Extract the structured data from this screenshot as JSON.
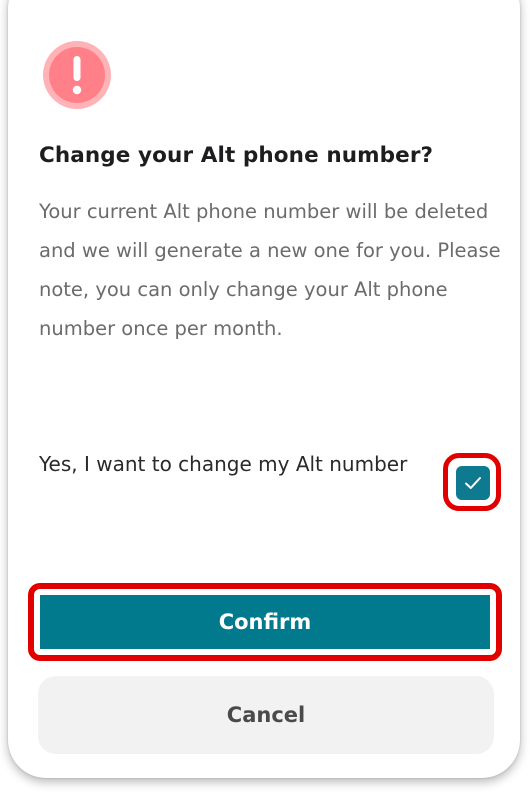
{
  "dialog": {
    "icon": "exclamation-circle-icon",
    "title": "Change your Alt phone number?",
    "description": "Your current Alt phone number will be deleted and we will generate a new one for you. Please note, you can only change your Alt phone number once per month."
  },
  "consent": {
    "label": "Yes, I want to change my Alt number",
    "checked": true,
    "icon": "checkmark-icon"
  },
  "buttons": {
    "confirm_label": "Confirm",
    "cancel_label": "Cancel"
  },
  "colors": {
    "accent": "#007a8c",
    "checkbox": "#0e7a8f",
    "alert_icon": "#ff8a8f",
    "highlight": "#e00000"
  }
}
